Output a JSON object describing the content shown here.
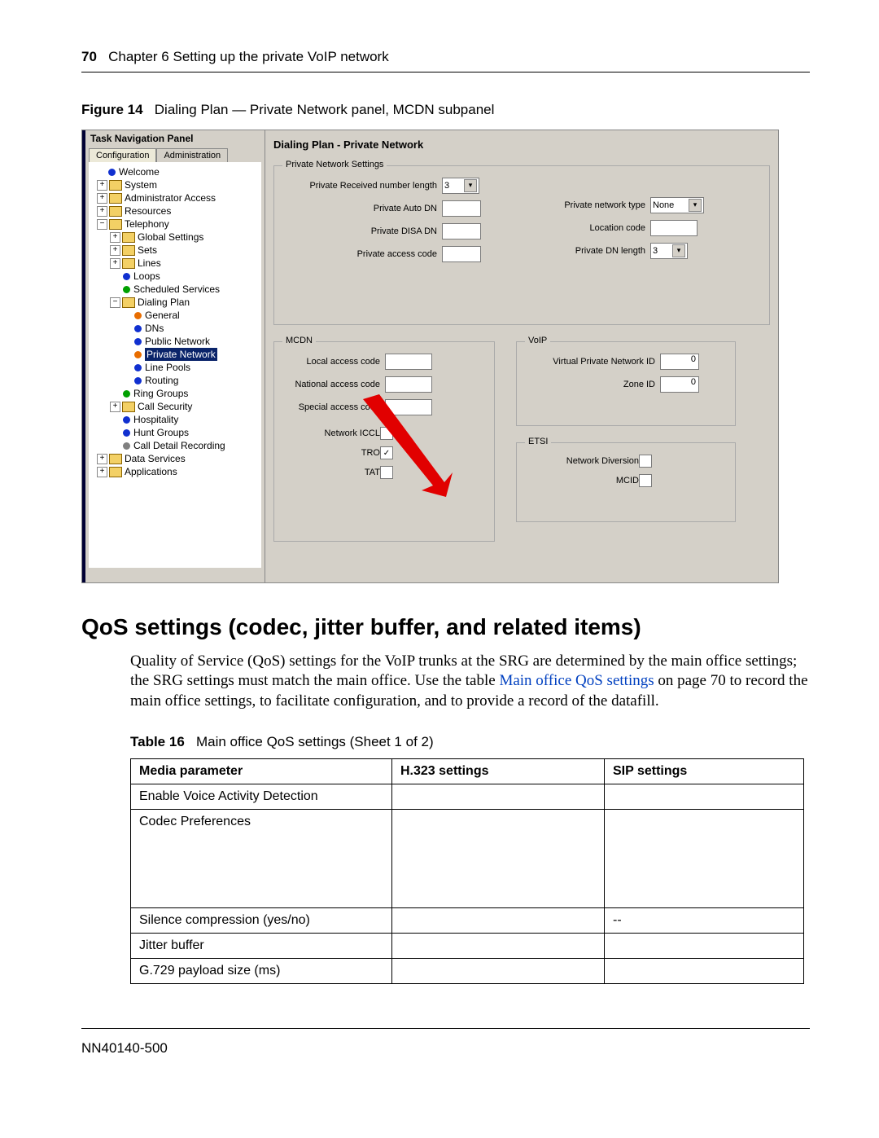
{
  "header": {
    "page": "70",
    "chapter": "Chapter 6  Setting up the private VoIP network"
  },
  "figure": {
    "label": "Figure 14",
    "caption": "Dialing Plan — Private Network panel, MCDN subpanel"
  },
  "nav": {
    "title": "Task Navigation Panel",
    "tabs": {
      "a": "Configuration",
      "b": "Administration"
    },
    "items": {
      "welcome": "Welcome",
      "system": "System",
      "admin": "Administrator Access",
      "resources": "Resources",
      "telephony": "Telephony",
      "global": "Global Settings",
      "sets": "Sets",
      "lines": "Lines",
      "loops": "Loops",
      "sched": "Scheduled Services",
      "dplan": "Dialing Plan",
      "general": "General",
      "dns": "DNs",
      "pubnet": "Public Network",
      "privnet": "Private Network",
      "linepools": "Line Pools",
      "routing": "Routing",
      "ring": "Ring Groups",
      "callsec": "Call Security",
      "hosp": "Hospitality",
      "hunt": "Hunt Groups",
      "cdr": "Call Detail Recording",
      "datas": "Data Services",
      "apps": "Applications"
    }
  },
  "panel": {
    "title": "Dialing Plan - Private Network",
    "pns": {
      "legend": "Private Network Settings",
      "recv": "Private Received number length",
      "recv_v": "3",
      "auto": "Private Auto DN",
      "disa": "Private DISA DN",
      "access": "Private access code",
      "ntype": "Private network type",
      "ntype_v": "None",
      "loc": "Location code",
      "dnlen": "Private DN length",
      "dnlen_v": "3"
    },
    "mcdn": {
      "legend": "MCDN",
      "local": "Local access code",
      "natl": "National access code",
      "spec": "Special access code",
      "iccl": "Network ICCL",
      "tro": "TRO",
      "tat": "TAT"
    },
    "voip": {
      "legend": "VoIP",
      "vpn": "Virtual Private Network ID",
      "vpn_v": "0",
      "zone": "Zone ID",
      "zone_v": "0"
    },
    "etsi": {
      "legend": "ETSI",
      "div": "Network Diversion",
      "mcid": "MCID"
    }
  },
  "section": {
    "h": "QoS settings (codec, jitter buffer, and related items)",
    "p1a": "Quality of Service (QoS) settings for the VoIP trunks at the SRG are determined by the main office settings; the SRG settings must match the main office. Use the table ",
    "link": "Main office QoS settings",
    "p1b": " on page 70 to record the main office settings, to facilitate configuration, and to provide a record of the datafill."
  },
  "table": {
    "label": "Table 16",
    "caption": "Main office QoS settings (Sheet 1 of 2)",
    "h1": "Media parameter",
    "h2": "H.323 settings",
    "h3": "SIP settings",
    "r1": "Enable Voice Activity Detection",
    "r2": "Codec Preferences",
    "r3": "Silence compression (yes/no)",
    "r3s": "--",
    "r4": "Jitter buffer",
    "r5": "G.729 payload size (ms)"
  },
  "footer": {
    "doc": "NN40140-500"
  },
  "chart_data": {
    "type": "table",
    "title": "Main office QoS settings (Sheet 1 of 2)",
    "columns": [
      "Media parameter",
      "H.323 settings",
      "SIP settings"
    ],
    "rows": [
      [
        "Enable Voice Activity Detection",
        "",
        ""
      ],
      [
        "Codec Preferences",
        "",
        ""
      ],
      [
        "Silence compression (yes/no)",
        "",
        "--"
      ],
      [
        "Jitter buffer",
        "",
        ""
      ],
      [
        "G.729 payload size (ms)",
        "",
        ""
      ]
    ]
  }
}
